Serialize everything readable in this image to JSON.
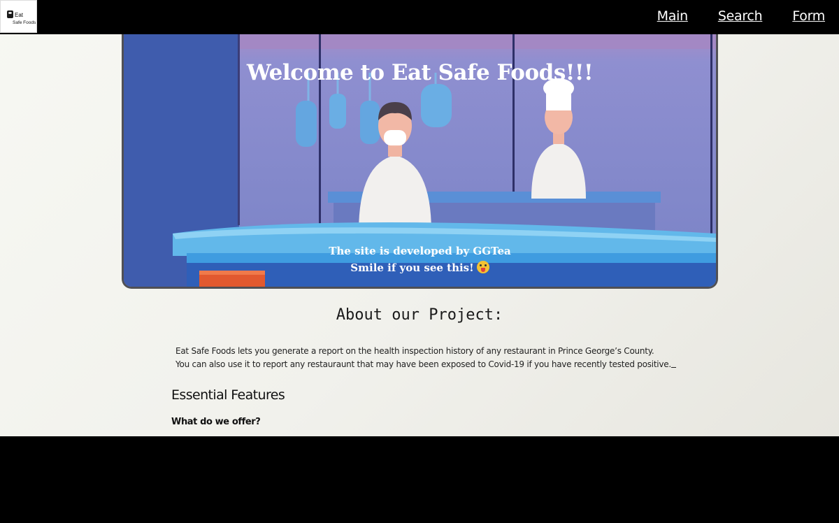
{
  "nav": {
    "logo": {
      "line1": "Eat",
      "line2": "Safe Foods"
    },
    "links": [
      "Main",
      "Search",
      "Form"
    ]
  },
  "hero": {
    "title": "Welcome to Eat Safe Foods!!!",
    "credit": "The site is developed by GGTea",
    "smile": "Smile if you see this!",
    "emoji_icon": "tongue-out-emoji-icon"
  },
  "about": {
    "title": "About our Project:",
    "line1": "Eat Safe Foods lets you generate a report on the health inspection history of any restaurant in Prince George’s County.",
    "line2": "You can also use it to report any restauraunt that may have been exposed to Covid-19 if you have recently tested positive."
  },
  "features": {
    "title": "Essential Features",
    "subtitle": "What do we offer?"
  },
  "colors": {
    "navbar": "#000000",
    "hero_bg": "#7e88c8",
    "counter": "#3aa0e0"
  }
}
